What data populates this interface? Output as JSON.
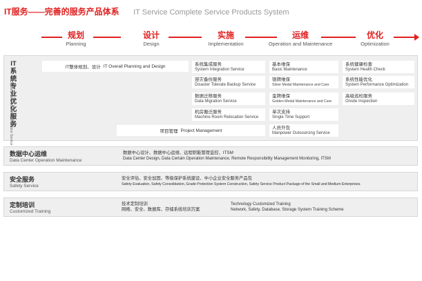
{
  "header": {
    "title_cn": "IT服务——完善的服务产品体系",
    "title_en": "IT Service Complete Service Products System"
  },
  "phases": [
    {
      "cn": "规划",
      "en": "Planning"
    },
    {
      "cn": "设计",
      "en": "Design"
    },
    {
      "cn": "实施",
      "en": "Implementation"
    },
    {
      "cn": "运维",
      "en": "Operation and Maintenance"
    },
    {
      "cn": "优化",
      "en": "Optimization"
    }
  ],
  "professional": {
    "label_cn": "IT系统专业优化服务",
    "label_en": "IT System Professional Optimization Service",
    "planning_design": {
      "cn": "IT整体规划、设计",
      "en": "IT Overall Planning and Design"
    },
    "implementation": [
      {
        "cn": "系统集成服务",
        "en": "System Integration Service"
      },
      {
        "cn": "容灾备份服务",
        "en": "Disaster Tolerate Backup Service"
      },
      {
        "cn": "数据迁移服务",
        "en": "Data Migration Service"
      },
      {
        "cn": "机房搬迁服务",
        "en": "Machine Room Relocation Service"
      }
    ],
    "operation": [
      {
        "cn": "基本维保",
        "en": "Basic Maintenance"
      },
      {
        "cn": "银牌维保",
        "en": "Silver Medal Maintenance and Care"
      },
      {
        "cn": "金牌维保",
        "en": "Golden Medal Maintenance and Care"
      },
      {
        "cn": "单次支持",
        "en": "Single Time Support"
      },
      {
        "cn": "人员外包",
        "en": "Manpower Outsourcing Service"
      }
    ],
    "optimization": [
      {
        "cn": "系统健康检查",
        "en": "System Health Check"
      },
      {
        "cn": "系统性能优化",
        "en": "System Performance Optimization"
      },
      {
        "cn": "高级巡检服务",
        "en": "Onsite Inspection"
      }
    ],
    "project_management": {
      "cn": "项目管理",
      "en": "Project Management"
    }
  },
  "datacenter": {
    "label_cn": "数据中心运维",
    "label_en": "Data Center Operation Maintenance",
    "text_cn": "数据中心设计、数据中心运维、远程职能管理监控、ITSM",
    "text_en": "Data Center Design, Data Certain Operation Maintenance, Remote Responsibility Management Monitoring, ITSM"
  },
  "security": {
    "label_cn": "安全服务",
    "label_en": "Safety Service",
    "text_cn": "安全评估、安全加固、等级保护系统建设、中小企业安全服务产品包",
    "text_en": "Safety Evaluation, Safety Consolidation, Grade Protection System Construction, Safety Service Product Package of the Small and Medium Enterprises."
  },
  "training": {
    "label_cn": "定制培训",
    "label_en": "Customized Training",
    "text_cn_1": "技术定制培训",
    "text_cn_2": "网络、安全、数据库、存储系统培训方案",
    "text_en_1": "Technology Customized Training",
    "text_en_2": "Network, Safety, Database, Storage System Training Scheme"
  },
  "colors": {
    "accent": "#e02020",
    "panel": "#efefef"
  }
}
